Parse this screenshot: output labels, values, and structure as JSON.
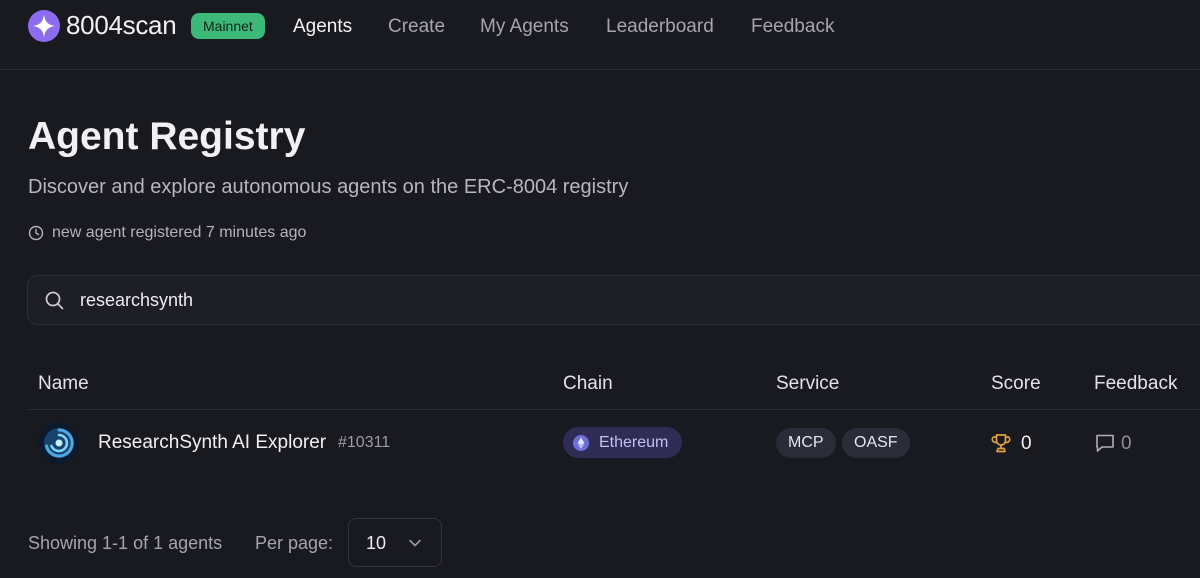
{
  "brand": {
    "name": "8004scan",
    "network_badge": "Mainnet"
  },
  "nav": {
    "items": [
      {
        "label": "Agents",
        "active": true
      },
      {
        "label": "Create",
        "active": false
      },
      {
        "label": "My Agents",
        "active": false
      },
      {
        "label": "Leaderboard",
        "active": false
      },
      {
        "label": "Feedback",
        "active": false
      }
    ]
  },
  "page": {
    "title": "Agent Registry",
    "subtitle": "Discover and explore autonomous agents on the ERC-8004 registry",
    "activity": "new agent registered 7 minutes ago"
  },
  "search": {
    "value": "researchsynth"
  },
  "table": {
    "columns": [
      "Name",
      "Chain",
      "Service",
      "Score",
      "Feedback"
    ],
    "rows": [
      {
        "name": "ResearchSynth AI Explorer",
        "id": "#10311",
        "chain": "Ethereum",
        "services": [
          "MCP",
          "OASF"
        ],
        "score": "0",
        "feedback": "0"
      }
    ]
  },
  "footer": {
    "showing": "Showing 1-1 of 1 agents",
    "per_page_label": "Per page:",
    "per_page_value": "10"
  },
  "colors": {
    "background": "#191920",
    "network_badge": "#3cb878",
    "chain_pill": "#2f2c55",
    "logo_accent": "#8d6cf2",
    "trophy": "#e0a23b"
  },
  "icons": {
    "logo": "brand-star-logo",
    "activity": "clock-icon",
    "search": "search-icon",
    "chain": "ethereum-icon",
    "score": "trophy-icon",
    "feedback": "chat-bubble-icon",
    "select": "chevron-down-icon"
  }
}
